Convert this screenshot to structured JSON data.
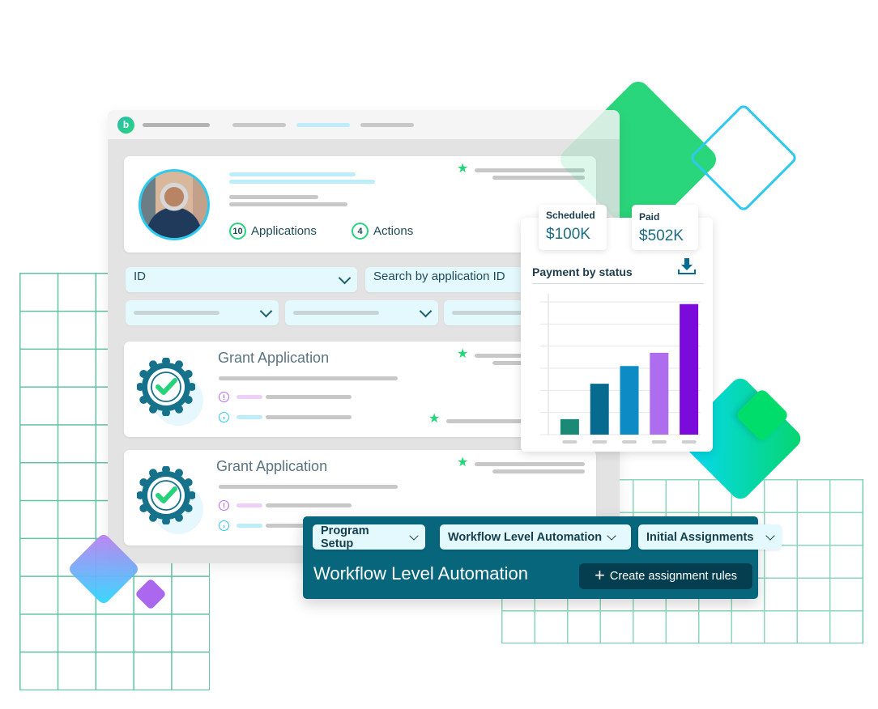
{
  "window": {
    "logo_letter": "b",
    "nav_tabs": [
      {
        "name": "nav-placeholder-1",
        "active": false
      },
      {
        "name": "nav-placeholder-2",
        "active": true
      },
      {
        "name": "nav-placeholder-3",
        "active": false
      }
    ]
  },
  "profile": {
    "avatar_alt": "User portrait",
    "applications_count": "10",
    "applications_label": "Applications",
    "actions_count": "4",
    "actions_label": "Actions"
  },
  "filters": {
    "id_select_label": "ID",
    "search_placeholder": "Search by application ID"
  },
  "applications": [
    {
      "title": "Grant Application"
    },
    {
      "title": "Grant Application"
    }
  ],
  "payment": {
    "scheduled_label": "Scheduled",
    "scheduled_value": "$100K",
    "paid_label": "Paid",
    "paid_value": "$502K",
    "title": "Payment by status",
    "download_icon": "download-icon"
  },
  "chart_data": {
    "type": "bar",
    "title": "Payment by status",
    "categories": [
      "",
      "",
      "",
      "",
      ""
    ],
    "values": [
      0.7,
      2.3,
      3.1,
      3.7,
      5.9
    ],
    "colors": [
      "#1a8a76",
      "#076b8f",
      "#0d8bc4",
      "#ae6cee",
      "#7a0bdb"
    ],
    "xlabel": "",
    "ylabel": "",
    "ylim": [
      0,
      6
    ],
    "grid": true
  },
  "workflow": {
    "breadcrumbs": [
      {
        "label": "Program Setup"
      },
      {
        "label": "Workflow Level Automation"
      },
      {
        "label": "Initial Assignments"
      }
    ],
    "title": "Workflow Level Automation",
    "create_button_label": "Create assignment rules"
  }
}
